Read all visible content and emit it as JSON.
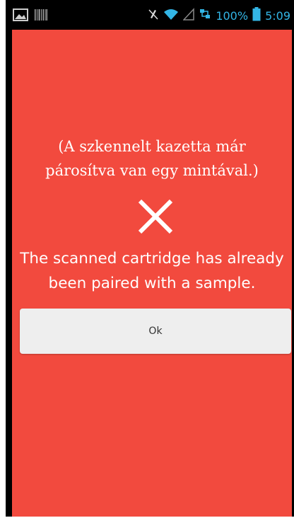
{
  "status_bar": {
    "battery_percent": "100%",
    "time": "5:09",
    "text_color": "#33b5e5",
    "icons": [
      "image-icon",
      "barcode-icon",
      "mute-icon",
      "wifi-icon",
      "signal-icon",
      "network-icon",
      "battery-icon"
    ]
  },
  "dialog": {
    "background": "#f24a3e",
    "message_hu": "(A szkennelt kazetta már párosítva van egy mintával.)",
    "icon": "close-x-icon",
    "message_en": "The scanned cartridge has already been paired with a sample.",
    "ok_label": "Ok"
  }
}
